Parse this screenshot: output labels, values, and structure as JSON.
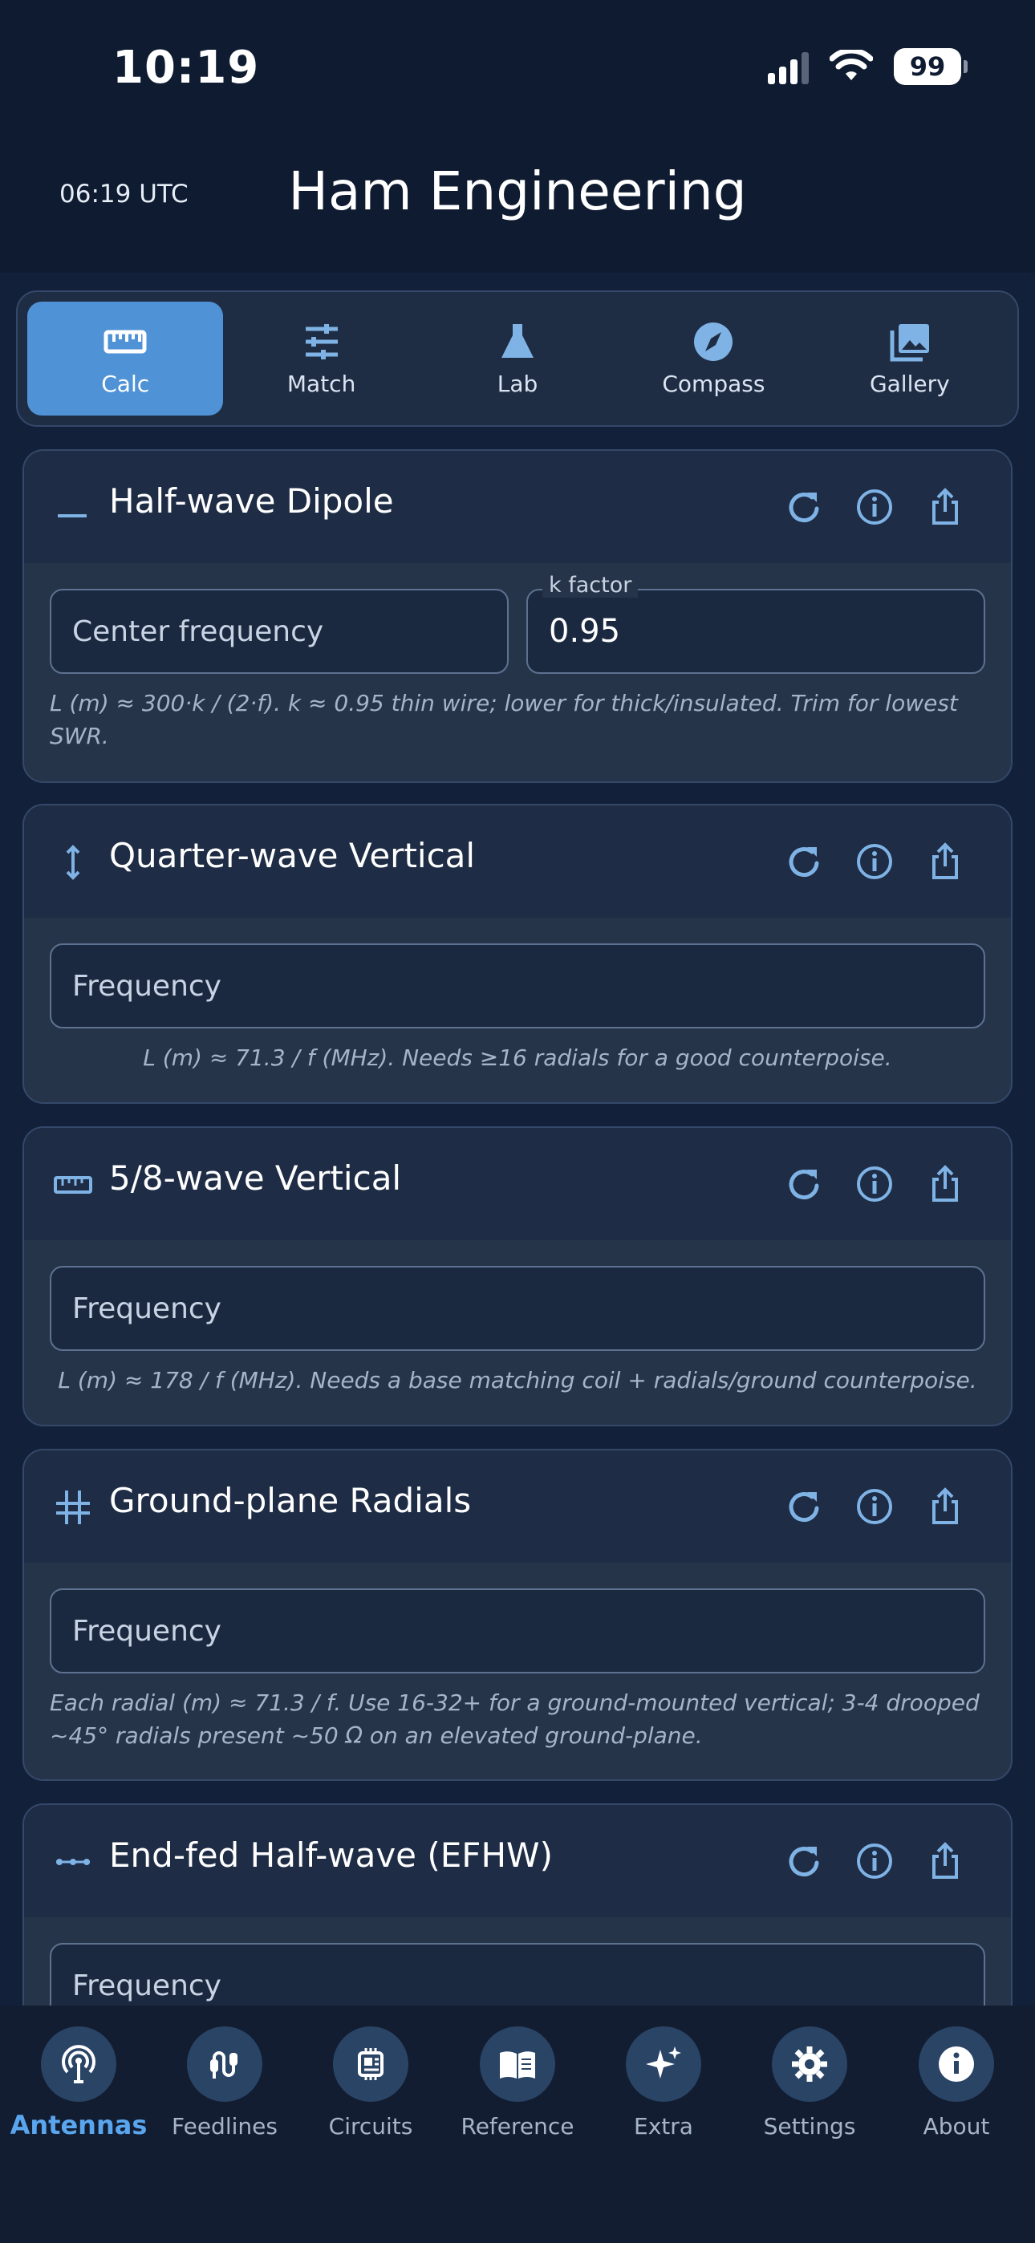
{
  "status_bar": {
    "time": "10:19",
    "battery": "99"
  },
  "header": {
    "utc": "06:19 UTC",
    "title": "Ham Engineering"
  },
  "segments": [
    {
      "label": "Calc",
      "icon": "ruler-icon",
      "active": true
    },
    {
      "label": "Match",
      "icon": "sliders-icon",
      "active": false
    },
    {
      "label": "Lab",
      "icon": "flask-icon",
      "active": false
    },
    {
      "label": "Compass",
      "icon": "compass-icon",
      "active": false
    },
    {
      "label": "Gallery",
      "icon": "gallery-icon",
      "active": false
    }
  ],
  "cards": [
    {
      "title": "Half-wave Dipole",
      "icon": "dipole-icon",
      "fields": [
        {
          "placeholder": "Center frequency",
          "value": ""
        },
        {
          "label": "k factor",
          "value": "0.95"
        }
      ],
      "note": "L (m) ≈ 300·k / (2·f).  k ≈ 0.95 thin wire; lower for thick/insulated. Trim for lowest SWR."
    },
    {
      "title": "Quarter-wave Vertical",
      "icon": "vertical-arrows-icon",
      "fields": [
        {
          "placeholder": "Frequency"
        }
      ],
      "note": "L (m) ≈ 71.3 / f (MHz). Needs ≥16 radials for a good counterpoise."
    },
    {
      "title": "5/8-wave Vertical",
      "icon": "ruler-icon",
      "fields": [
        {
          "placeholder": "Frequency"
        }
      ],
      "note": "L (m) ≈ 178 / f (MHz). Needs a base matching coil + radials/ground counterpoise."
    },
    {
      "title": "Ground-plane Radials",
      "icon": "grid-icon",
      "fields": [
        {
          "placeholder": "Frequency"
        }
      ],
      "note": "Each radial (m) ≈ 71.3 / f. Use 16-32+ for a ground-mounted vertical; 3-4 drooped ~45° radials present ~50 Ω on an elevated ground-plane."
    },
    {
      "title": "End-fed Half-wave (EFHW)",
      "icon": "end-fed-icon",
      "fields": [
        {
          "placeholder": "Frequency"
        }
      ]
    }
  ],
  "bottom_nav": [
    {
      "label": "Antennas",
      "icon": "antenna-icon",
      "active": true
    },
    {
      "label": "Feedlines",
      "icon": "cable-icon",
      "active": false
    },
    {
      "label": "Circuits",
      "icon": "circuit-icon",
      "active": false
    },
    {
      "label": "Reference",
      "icon": "book-icon",
      "active": false
    },
    {
      "label": "Extra",
      "icon": "sparkles-icon",
      "active": false
    },
    {
      "label": "Settings",
      "icon": "gear-icon",
      "active": false
    },
    {
      "label": "About",
      "icon": "info-icon",
      "active": false
    }
  ],
  "colors": {
    "accent": "#4f93d6",
    "active_nav": "#5aa6ee",
    "background": "#13203a",
    "card": "#263449"
  }
}
